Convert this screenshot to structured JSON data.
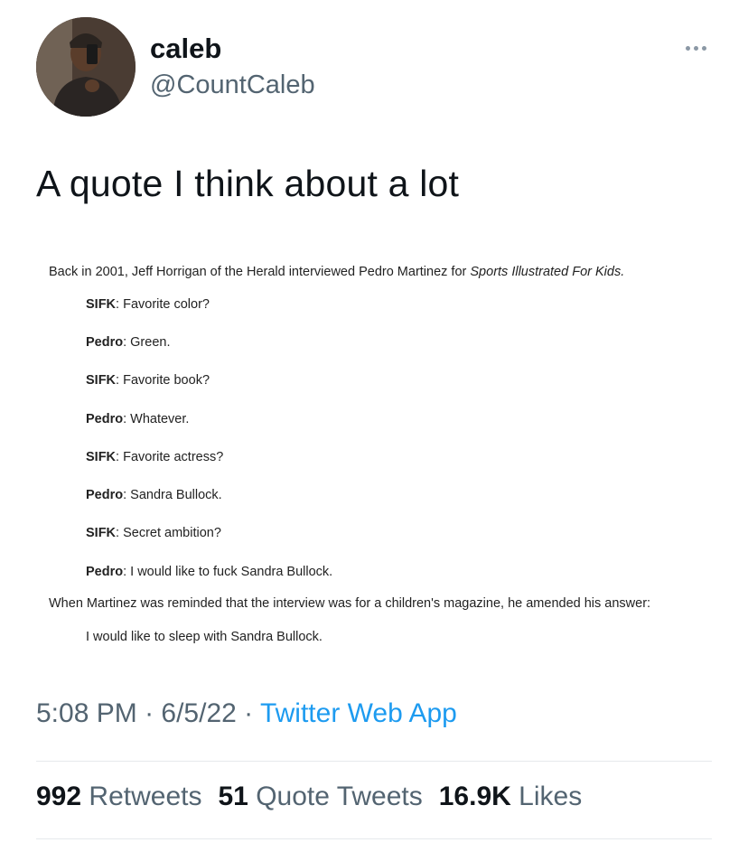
{
  "author": {
    "name": "caleb",
    "handle": "@CountCaleb"
  },
  "tweet": {
    "text": "A quote I think about a lot",
    "time": "5:08 PM",
    "date": "6/5/22",
    "app": "Twitter Web App"
  },
  "quote_image": {
    "intro_prefix": "Back in 2001, Jeff Horrigan of the Herald interviewed Pedro Martinez for ",
    "intro_pub": "Sports Illustrated For Kids.",
    "qa": [
      {
        "speaker": "SIFK",
        "text": ": Favorite color?"
      },
      {
        "speaker": "Pedro",
        "text": ": Green."
      },
      {
        "speaker": "SIFK",
        "text": ": Favorite book?"
      },
      {
        "speaker": "Pedro",
        "text": ": Whatever."
      },
      {
        "speaker": "SIFK",
        "text": ": Favorite actress?"
      },
      {
        "speaker": "Pedro",
        "text": ": Sandra Bullock."
      },
      {
        "speaker": "SIFK",
        "text": ": Secret ambition?"
      },
      {
        "speaker": "Pedro",
        "text": ": I would like to fuck Sandra Bullock."
      }
    ],
    "followup": "When Martinez was reminded that the interview was for a children's magazine, he amended his answer:",
    "amended": "I would like to sleep with Sandra Bullock."
  },
  "stats": {
    "retweets_count": "992",
    "retweets_label": "Retweets",
    "quotes_count": "51",
    "quotes_label": "Quote Tweets",
    "likes_count": "16.9K",
    "likes_label": "Likes"
  },
  "icons": {
    "more": "more-options-icon"
  }
}
